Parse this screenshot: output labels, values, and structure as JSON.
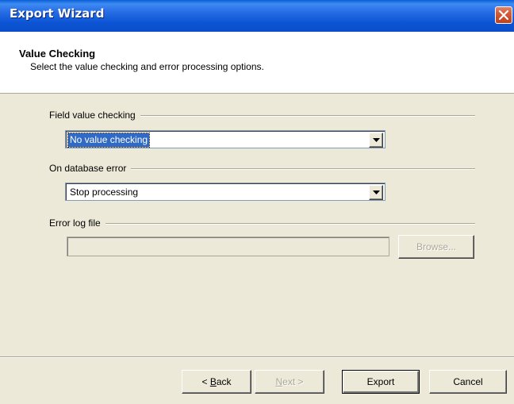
{
  "window": {
    "title": "Export Wizard"
  },
  "header": {
    "title": "Value Checking",
    "subtitle": "Select the value checking and error processing options."
  },
  "field_value_checking": {
    "label": "Field value checking",
    "selected": "No value checking"
  },
  "on_database_error": {
    "label": "On database error",
    "selected": "Stop processing"
  },
  "error_log_file": {
    "label": "Error log file",
    "value": "",
    "browse_label": "Browse..."
  },
  "footer": {
    "back_prefix": "< ",
    "back_mnemonic": "B",
    "back_rest": "ack",
    "next_mnemonic": "N",
    "next_rest": "ext >",
    "export_label": "Export",
    "cancel_label": "Cancel"
  },
  "icons": {
    "close": "close-icon",
    "dropdown": "chevron-down-icon"
  },
  "colors": {
    "titlebar": "#0c55d6",
    "selection": "#316ac5",
    "dialog_bg": "#ece9d8"
  }
}
